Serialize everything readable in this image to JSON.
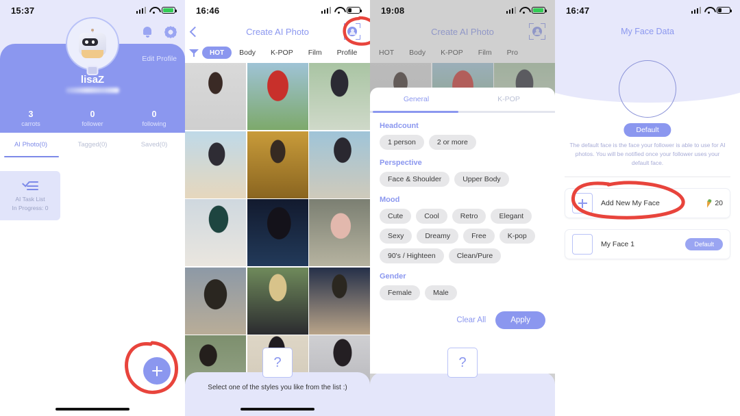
{
  "panel1": {
    "status": {
      "time": "15:37",
      "battery_state": "charging"
    },
    "icons": {
      "bell": "bell-icon",
      "gear": "gear-icon"
    },
    "edit_profile": "Edit Profile",
    "username": "lisaZ",
    "stats": [
      {
        "num": "3",
        "label": "carrots"
      },
      {
        "num": "0",
        "label": "follower"
      },
      {
        "num": "0",
        "label": "following"
      }
    ],
    "tabs": [
      {
        "label": "AI Photo(0)",
        "active": true
      },
      {
        "label": "Tagged(0)",
        "active": false
      },
      {
        "label": "Saved(0)",
        "active": false
      }
    ],
    "task_card": {
      "line1": "AI Task List",
      "line2": "In Progress: 0"
    },
    "fab": "+",
    "annotation": "red-circle-around-add-button"
  },
  "panel2": {
    "status": {
      "time": "16:46",
      "battery_state": "low"
    },
    "title": "Create AI Photo",
    "back": "back-chevron",
    "face_scan": "face-scan-icon",
    "filter_icon": "filter-icon",
    "chips": [
      {
        "label": "HOT",
        "active": true
      },
      {
        "label": "Body",
        "active": false
      },
      {
        "label": "K-POP",
        "active": false
      },
      {
        "label": "Film",
        "active": false
      },
      {
        "label": "Profile",
        "active": false
      }
    ],
    "hint": "Select one of the styles you like from the list :)",
    "question_card": "?",
    "annotation": "red-circle-around-face-scan-icon"
  },
  "panel3": {
    "status": {
      "time": "19:08",
      "battery_state": "charging"
    },
    "title": "Create AI Photo",
    "chips": [
      {
        "label": "HOT"
      },
      {
        "label": "Body"
      },
      {
        "label": "K-POP"
      },
      {
        "label": "Film"
      },
      {
        "label": "Pro"
      }
    ],
    "modal_tabs": [
      {
        "label": "General",
        "active": true
      },
      {
        "label": "K-POP",
        "active": false
      }
    ],
    "sections": [
      {
        "title": "Headcount",
        "options": [
          "1 person",
          "2 or more"
        ]
      },
      {
        "title": "Perspective",
        "options": [
          "Face & Shoulder",
          "Upper Body"
        ]
      },
      {
        "title": "Mood",
        "options": [
          "Cute",
          "Cool",
          "Retro",
          "Elegant",
          "Sexy",
          "Dreamy",
          "Free",
          "K-pop",
          "90's / Highteen",
          "Clean/Pure"
        ]
      },
      {
        "title": "Gender",
        "options": [
          "Female",
          "Male"
        ]
      }
    ],
    "clear_all": "Clear All",
    "apply": "Apply",
    "question_card": "?"
  },
  "panel4": {
    "status": {
      "time": "16:47",
      "battery_state": "low"
    },
    "title": "My Face Data",
    "default_pill": "Default",
    "description": "The default face is the face your follower is able to use for AI photos. You will be notified once your follower uses your default face.",
    "rows": [
      {
        "label": "Add New My Face",
        "cost": "20",
        "cost_icon": "carrot-icon",
        "kind": "add"
      },
      {
        "label": "My Face 1",
        "badge": "Default",
        "kind": "face"
      }
    ],
    "annotation": "red-circle-around-add-new-my-face"
  },
  "colors": {
    "accent": "#8b97ef",
    "accent_light": "#e7e8fb",
    "annotation_red": "#e8443c",
    "chip_gray": "#e7e7e9"
  }
}
